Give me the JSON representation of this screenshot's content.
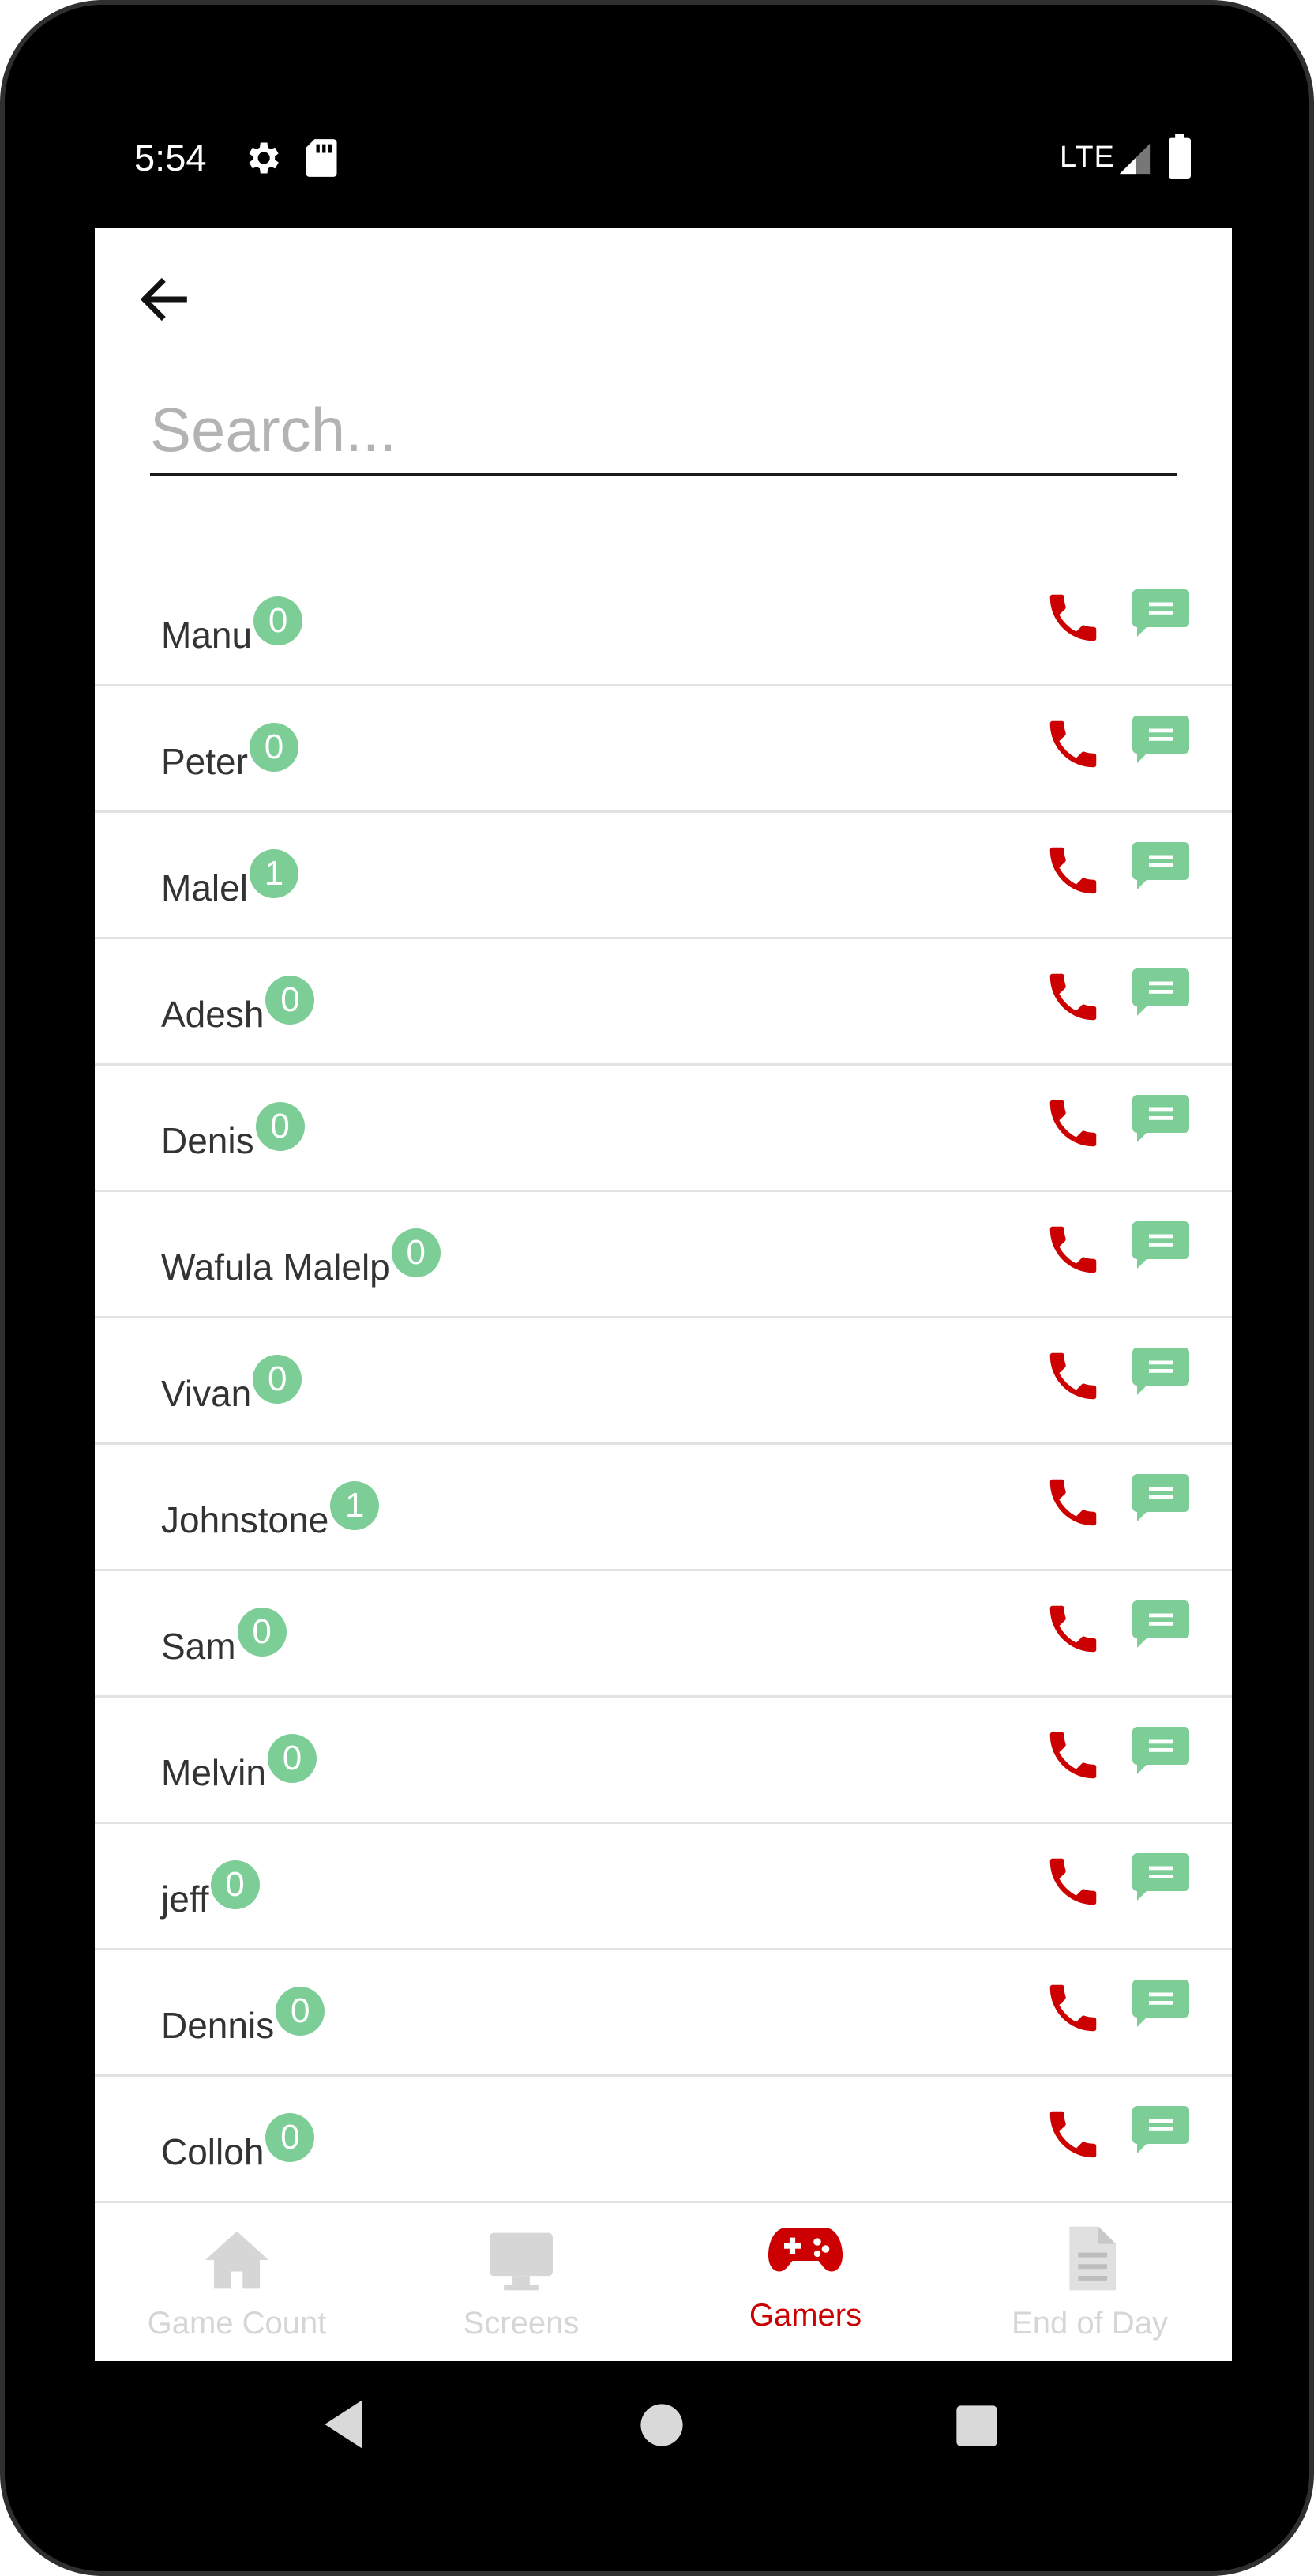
{
  "status_bar": {
    "time": "5:54",
    "network": "LTE",
    "icons": [
      "gear-icon",
      "sd-card-icon",
      "signal-icon",
      "battery-icon"
    ]
  },
  "header": {
    "back_icon": "arrow-left-icon"
  },
  "search": {
    "placeholder": "Search...",
    "value": ""
  },
  "gamers": [
    {
      "name": "Manu",
      "count": "0"
    },
    {
      "name": "Peter",
      "count": "0"
    },
    {
      "name": "Malel",
      "count": "1"
    },
    {
      "name": "Adesh",
      "count": "0"
    },
    {
      "name": "Denis",
      "count": "0"
    },
    {
      "name": "Wafula Malelp",
      "count": "0"
    },
    {
      "name": "Vivan",
      "count": "0"
    },
    {
      "name": "Johnstone",
      "count": "1"
    },
    {
      "name": "Sam",
      "count": "0"
    },
    {
      "name": "Melvin",
      "count": "0"
    },
    {
      "name": "jeff",
      "count": "0"
    },
    {
      "name": "Dennis",
      "count": "0"
    },
    {
      "name": "Colloh",
      "count": "0"
    }
  ],
  "row_actions": {
    "call_icon": "phone-icon",
    "message_icon": "message-icon"
  },
  "bottom_nav": {
    "items": [
      {
        "label": "Game Count",
        "icon": "home-icon",
        "active": false
      },
      {
        "label": "Screens",
        "icon": "monitor-icon",
        "active": false
      },
      {
        "label": "Gamers",
        "icon": "gamepad-icon",
        "active": true
      },
      {
        "label": "End of Day",
        "icon": "document-icon",
        "active": false
      }
    ]
  },
  "colors": {
    "accent_red": "#cc0000",
    "badge_green": "#7ccd96",
    "inactive_gray": "#d6d6d6"
  }
}
